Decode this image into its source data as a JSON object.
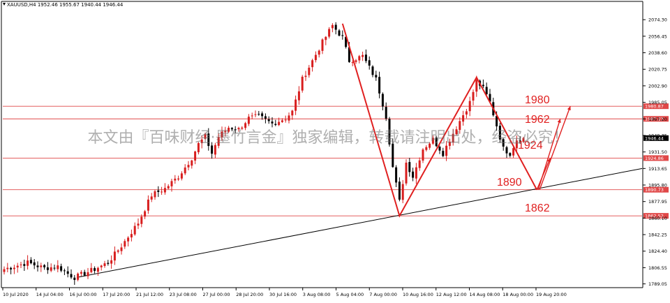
{
  "chart_data": {
    "type": "candlestick",
    "symbol_header": "XAUUSD,H4  1952.46 1955.67 1940.44 1946.44",
    "current_price": "1946.44",
    "y_range": [
      1785,
      2085
    ],
    "y_ticks": [
      "2074.30",
      "2056.45",
      "2038.60",
      "2020.75",
      "2002.90",
      "1985.05",
      "1967.20",
      "1949.35",
      "1931.50",
      "1913.65",
      "1895.80",
      "1877.95",
      "1860.10",
      "1842.25",
      "1824.40",
      "1806.55",
      "1789.05"
    ],
    "x_ticks": [
      "10 Jul 2020",
      "14 Jul 04:00",
      "16 Jul 00:00",
      "17 Jul 20:00",
      "21 Jul 12:00",
      "23 Jul 08:00",
      "27 Jul 00:00",
      "28 Jul 20:00",
      "30 Jul 16:00",
      "3 Aug 08:00",
      "5 Aug 04:00",
      "7 Aug 00:00",
      "10 Aug 16:00",
      "12 Aug 12:00",
      "14 Aug 08:00",
      "18 Aug 00:00",
      "19 Aug 20:00"
    ],
    "horizontal_levels": [
      {
        "value": 1980.87,
        "label": "1980.87"
      },
      {
        "value": 1967.23,
        "label": "1967.23"
      },
      {
        "value": 1924.86,
        "label": "1924.86"
      },
      {
        "value": 1890.73,
        "label": "1890.73"
      },
      {
        "value": 1862.52,
        "label": "1862.52"
      }
    ],
    "annotations": [
      "1980",
      "1962",
      "1924",
      "1890",
      "1862"
    ],
    "waypoints": [
      {
        "bar": 0,
        "price": 1805
      },
      {
        "bar": 7,
        "price": 1812
      },
      {
        "bar": 12,
        "price": 1806
      },
      {
        "bar": 16,
        "price": 1808
      },
      {
        "bar": 19,
        "price": 1800
      },
      {
        "bar": 21,
        "price": 1796
      },
      {
        "bar": 27,
        "price": 1805
      },
      {
        "bar": 31,
        "price": 1812
      },
      {
        "bar": 35,
        "price": 1830
      },
      {
        "bar": 40,
        "price": 1855
      },
      {
        "bar": 44,
        "price": 1885
      },
      {
        "bar": 48,
        "price": 1892
      },
      {
        "bar": 52,
        "price": 1905
      },
      {
        "bar": 56,
        "price": 1925
      },
      {
        "bar": 58,
        "price": 1940
      },
      {
        "bar": 60,
        "price": 1948
      },
      {
        "bar": 62,
        "price": 1930
      },
      {
        "bar": 64,
        "price": 1948
      },
      {
        "bar": 67,
        "price": 1958
      },
      {
        "bar": 70,
        "price": 1956
      },
      {
        "bar": 73,
        "price": 1968
      },
      {
        "bar": 76,
        "price": 1970
      },
      {
        "bar": 80,
        "price": 1962
      },
      {
        "bar": 84,
        "price": 1968
      },
      {
        "bar": 86,
        "price": 1975
      },
      {
        "bar": 89,
        "price": 2010
      },
      {
        "bar": 92,
        "price": 2030
      },
      {
        "bar": 95,
        "price": 2050
      },
      {
        "bar": 98,
        "price": 2068
      },
      {
        "bar": 101,
        "price": 2055
      },
      {
        "bar": 103,
        "price": 2030
      },
      {
        "bar": 107,
        "price": 2035
      },
      {
        "bar": 111,
        "price": 2010
      },
      {
        "bar": 114,
        "price": 1970
      },
      {
        "bar": 116,
        "price": 1915
      },
      {
        "bar": 118,
        "price": 1878
      },
      {
        "bar": 120,
        "price": 1920
      },
      {
        "bar": 122,
        "price": 1905
      },
      {
        "bar": 125,
        "price": 1935
      },
      {
        "bar": 128,
        "price": 1945
      },
      {
        "bar": 131,
        "price": 1930
      },
      {
        "bar": 133,
        "price": 1945
      },
      {
        "bar": 136,
        "price": 1965
      },
      {
        "bar": 139,
        "price": 1985
      },
      {
        "bar": 141,
        "price": 2008
      },
      {
        "bar": 143,
        "price": 2000
      },
      {
        "bar": 145,
        "price": 1985
      },
      {
        "bar": 147,
        "price": 1960
      },
      {
        "bar": 149,
        "price": 1935
      },
      {
        "bar": 151,
        "price": 1930
      },
      {
        "bar": 153,
        "price": 1945
      },
      {
        "bar": 155,
        "price": 1946.44
      }
    ]
  },
  "watermark_text": "本文由『百味财经·墨竹言金』独家编辑，转载请注明出处，经盗必究！",
  "colors": {
    "bull": "#d81e1e",
    "bear": "#000000",
    "level_line": "#e04848",
    "level_label_bg": "#e04848",
    "annotation": "#e02020",
    "trendline": "#000000",
    "axis": "#000000"
  }
}
